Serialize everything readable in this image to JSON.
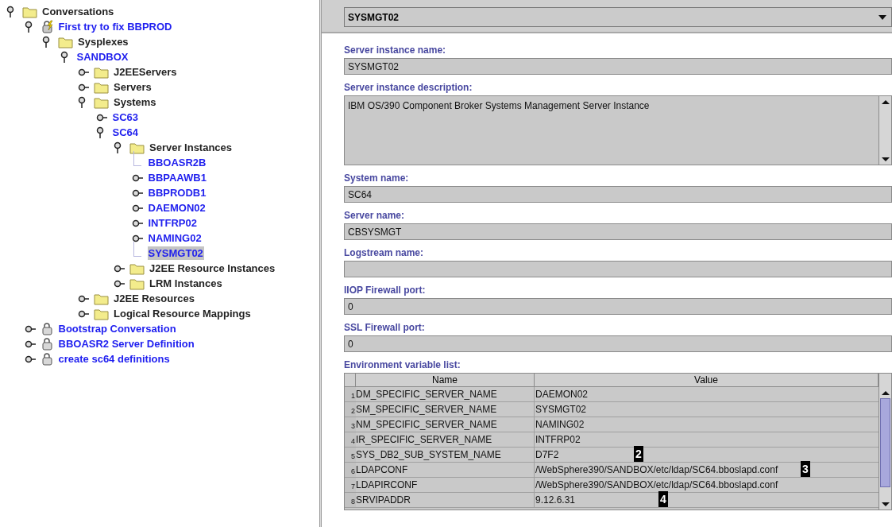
{
  "tree": [
    {
      "label": "Conversations",
      "kind": "folder",
      "expanded": true,
      "children": [
        {
          "label": "First try to fix BBPROD",
          "kind": "active-conversation",
          "expanded": true,
          "children": [
            {
              "label": "Sysplexes",
              "kind": "folder",
              "expanded": true,
              "children": [
                {
                  "label": "SANDBOX",
                  "kind": "entity",
                  "expanded": true,
                  "children": [
                    {
                      "label": "J2EEServers",
                      "kind": "folder",
                      "expanded": false
                    },
                    {
                      "label": "Servers",
                      "kind": "folder",
                      "expanded": false
                    },
                    {
                      "label": "Systems",
                      "kind": "folder",
                      "expanded": true,
                      "children": [
                        {
                          "label": "SC63",
                          "kind": "entity",
                          "expanded": false
                        },
                        {
                          "label": "SC64",
                          "kind": "entity",
                          "expanded": true,
                          "children": [
                            {
                              "label": "Server Instances",
                              "kind": "folder",
                              "expanded": true,
                              "children": [
                                {
                                  "label": "BBOASR2B",
                                  "kind": "entity",
                                  "selected": false
                                },
                                {
                                  "label": "BBPAAWB1",
                                  "kind": "entity",
                                  "expanded": false,
                                  "selected": false
                                },
                                {
                                  "label": "BBPRODB1",
                                  "kind": "entity",
                                  "expanded": false,
                                  "selected": false
                                },
                                {
                                  "label": "DAEMON02",
                                  "kind": "entity",
                                  "expanded": false,
                                  "selected": false
                                },
                                {
                                  "label": "INTFRP02",
                                  "kind": "entity",
                                  "expanded": false,
                                  "selected": false
                                },
                                {
                                  "label": "NAMING02",
                                  "kind": "entity",
                                  "expanded": false,
                                  "selected": false
                                },
                                {
                                  "label": "SYSMGT02",
                                  "kind": "entity",
                                  "selected": true
                                }
                              ]
                            },
                            {
                              "label": "J2EE Resource Instances",
                              "kind": "folder",
                              "expanded": false
                            },
                            {
                              "label": "LRM Instances",
                              "kind": "folder",
                              "expanded": false
                            }
                          ]
                        }
                      ]
                    },
                    {
                      "label": "J2EE Resources",
                      "kind": "folder",
                      "expanded": false
                    },
                    {
                      "label": "Logical Resource Mappings",
                      "kind": "folder",
                      "expanded": false
                    }
                  ]
                }
              ]
            }
          ]
        },
        {
          "label": "Bootstrap Conversation",
          "kind": "conversation",
          "expanded": false
        },
        {
          "label": "BBOASR2 Server Definition",
          "kind": "conversation",
          "expanded": false
        },
        {
          "label": "create sc64 definitions",
          "kind": "conversation",
          "expanded": false
        }
      ]
    }
  ],
  "combo": {
    "value": "SYSMGT02"
  },
  "fields": [
    {
      "label": "Server instance name:",
      "kind": "text",
      "value": "SYSMGT02"
    },
    {
      "label": "Server instance description:",
      "kind": "textarea",
      "value": "IBM OS/390 Component Broker Systems Management Server Instance"
    },
    {
      "label": "System name:",
      "kind": "text",
      "value": "SC64"
    },
    {
      "label": "Server name:",
      "kind": "text",
      "value": "CBSYSMGT"
    },
    {
      "label": "Logstream name:",
      "kind": "text"
    },
    {
      "label": "IIOP Firewall port:",
      "kind": "text",
      "value": "0"
    },
    {
      "label": "SSL Firewall port:",
      "kind": "text",
      "value": "0"
    }
  ],
  "env_table": {
    "label": "Environment variable list:",
    "columns": [
      "Name",
      "Value"
    ],
    "rows": [
      {
        "number": "1",
        "name": "DM_SPECIFIC_SERVER_NAME",
        "value": "DAEMON02"
      },
      {
        "number": "2",
        "name": "SM_SPECIFIC_SERVER_NAME",
        "value": "SYSMGT02"
      },
      {
        "number": "3",
        "name": "NM_SPECIFIC_SERVER_NAME",
        "value": "NAMING02"
      },
      {
        "number": "4",
        "name": "IR_SPECIFIC_SERVER_NAME",
        "value": "INTFRP02"
      },
      {
        "number": "5",
        "name": "SYS_DB2_SUB_SYSTEM_NAME",
        "value": "D7F2"
      },
      {
        "number": "6",
        "name": "LDAPCONF",
        "value": "/WebSphere390/SANDBOX/etc/ldap/SC64.bboslapd.conf"
      },
      {
        "number": "7",
        "name": "LDAPIRCONF",
        "value": "/WebSphere390/SANDBOX/etc/ldap/SC64.bboslapd.conf"
      },
      {
        "number": "8",
        "name": "SRVIPADDR",
        "value": "9.12.6.31"
      }
    ]
  },
  "callouts": [
    "2",
    "3",
    "4"
  ]
}
